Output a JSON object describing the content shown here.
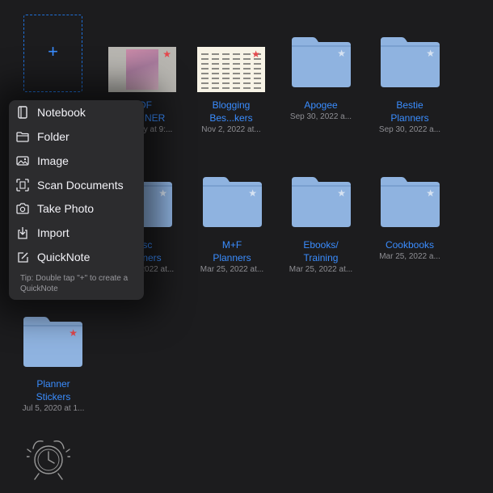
{
  "add_tile": {
    "glyph": "+"
  },
  "items": [
    {
      "id": "pdf-planner",
      "name": "PDF\nPLANNER",
      "date": "Yesterday at 9:..."
    },
    {
      "id": "blogging",
      "name": "Blogging\nBes...kers",
      "date": "Nov 2, 2022 at..."
    },
    {
      "id": "apogee",
      "name": "Apogee",
      "date": "Sep 30, 2022 a..."
    },
    {
      "id": "bestie",
      "name": "Bestie\nPlanners",
      "date": "Sep 30, 2022 a..."
    },
    {
      "id": "misc",
      "name": "Misc\nPlanners",
      "date": "Mar 25, 2022 at..."
    },
    {
      "id": "mf",
      "name": "M+F\nPlanners",
      "date": "Mar 25, 2022 at..."
    },
    {
      "id": "ebooks",
      "name": "Ebooks/\nTraining",
      "date": "Mar 25, 2022 at..."
    },
    {
      "id": "cookbooks",
      "name": "Cookbooks",
      "date": "Mar 25, 2022 a..."
    },
    {
      "id": "stickers",
      "name": "Planner\nStickers",
      "date": "Jul 5, 2020 at 1..."
    }
  ],
  "menu": {
    "items": [
      {
        "label": "Notebook",
        "icon": "notebook-icon"
      },
      {
        "label": "Folder",
        "icon": "folder-icon"
      },
      {
        "label": "Image",
        "icon": "image-icon"
      },
      {
        "label": "Scan Documents",
        "icon": "scan-icon"
      },
      {
        "label": "Take Photo",
        "icon": "camera-icon"
      },
      {
        "label": "Import",
        "icon": "import-icon"
      },
      {
        "label": "QuickNote",
        "icon": "quicknote-icon"
      }
    ],
    "tip": "Tip: Double tap \"+\" to create a QuickNote"
  },
  "colors": {
    "background": "#1c1c1e",
    "accent": "#3a8dff",
    "folder": "#8fb3e0",
    "favorite_star": "#e5484d",
    "star": "#d7e3f2"
  }
}
